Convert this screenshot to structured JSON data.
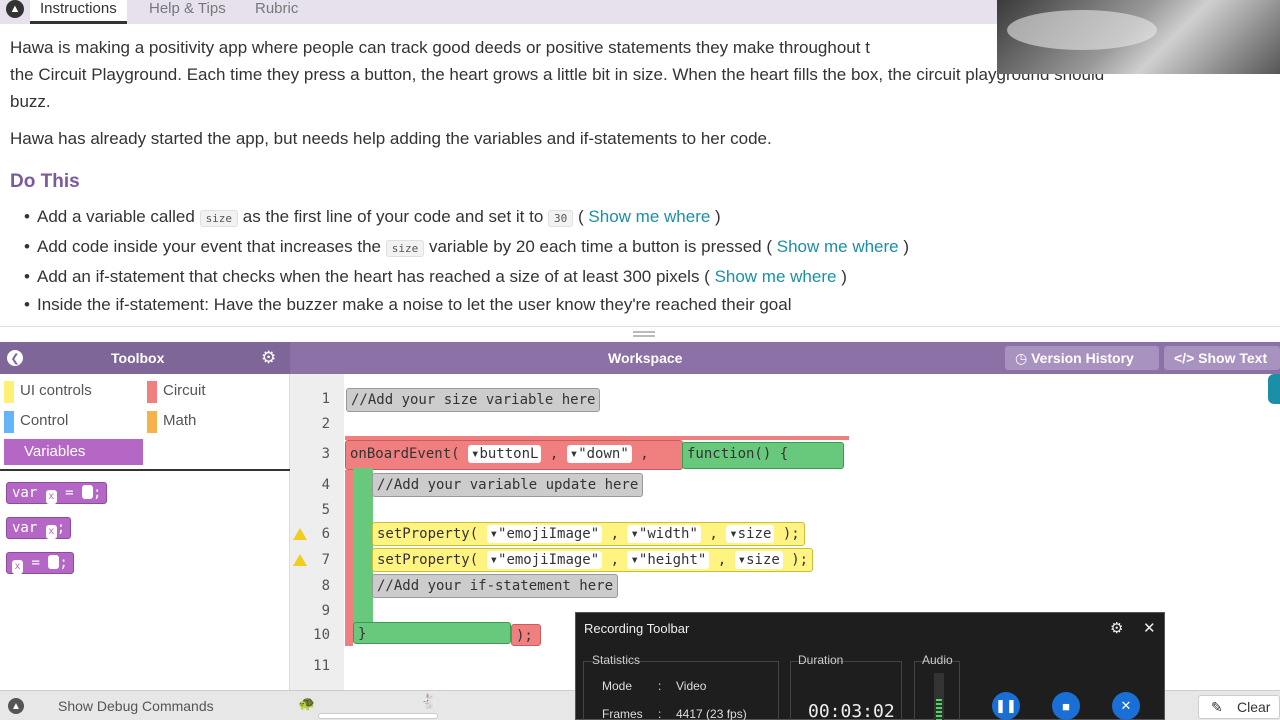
{
  "tabs": [
    "Instructions",
    "Help & Tips",
    "Rubric"
  ],
  "instructions": {
    "p1a": "Hawa is making a positivity app where people can track good deeds or positive statements they make throughout t",
    "p1b": "the Circuit Playground. Each time they press a button, the heart grows a little bit in size. When the heart fills the box, the circuit playground should",
    "p1c": "buzz.",
    "p2": "Hawa has already started the app, but needs help adding the variables and if-statements to her code.",
    "heading": "Do This",
    "tasks": {
      "t1a": "Add a variable called",
      "t1code": "size",
      "t1b": "as the first line of your code and set it to",
      "t1code2": "30",
      "t2a": "Add code inside your event that increases the",
      "t2code": "size",
      "t2b": "variable by 20 each time a button is pressed (",
      "t3": "Add an if-statement that checks when the heart has reached a size of at least 300 pixels (",
      "t4": "Inside the if-statement: Have the buzzer make a noise to let the user know they're reached their goal",
      "link": "Show me where",
      "lparen": "(",
      "rparen": ")"
    }
  },
  "toolbox": {
    "title": "Toolbox",
    "categories": {
      "ui": "UI controls",
      "circuit": "Circuit",
      "control": "Control",
      "math": "Math",
      "variables": "Variables"
    },
    "blocks": {
      "b1a": "var",
      "b1slot": "x",
      "b1b": "=",
      "b2a": "var",
      "b2slot": "x",
      "b3slot": "x",
      "b3b": "="
    }
  },
  "workspace": {
    "title": "Workspace",
    "version_history": "Version History",
    "show_text": "Show Text",
    "line_numbers": [
      "1",
      "2",
      "3",
      "4",
      "5",
      "6",
      "7",
      "8",
      "9",
      "10",
      "11"
    ],
    "code": {
      "c1": "//Add your size variable here",
      "c3a": "onBoardEvent(",
      "c3b": "▾buttonL",
      "c3c": ",",
      "c3d": "▾\"down\"",
      "c3e": ",",
      "c3f": "function() {",
      "c4": "//Add your variable update here",
      "c6a": "setProperty(",
      "c6b": "▾\"emojiImage\"",
      "c6c": ",",
      "c6d": "▾\"width\"",
      "c6e": ",",
      "c6f": "▾size",
      "c6g": ");",
      "c7a": "setProperty(",
      "c7b": "▾\"emojiImage\"",
      "c7c": ",",
      "c7d": "▾\"height\"",
      "c7e": ",",
      "c7f": "▾size",
      "c7g": ");",
      "c8": "//Add your if-statement here",
      "c10a": "}",
      "c10b": ");"
    }
  },
  "debug": {
    "label": "Show Debug Commands",
    "clear": "Clear"
  },
  "recording": {
    "title": "Recording Toolbar",
    "statistics": "Statistics",
    "mode_label": "Mode",
    "mode_sep": ":",
    "mode_value": "Video",
    "frames_label": "Frames",
    "frames_sep": ":",
    "frames_value": "4417 (23 fps)",
    "duration": "Duration",
    "duration_value": "00:03:02",
    "audio": "Audio"
  },
  "colors": {
    "purple_header": "#7f6699",
    "variables": "#b567c6",
    "event_red": "#f08080",
    "function_green": "#68c97d",
    "setproperty_yellow": "#fff382",
    "link": "#1a8fa6"
  }
}
